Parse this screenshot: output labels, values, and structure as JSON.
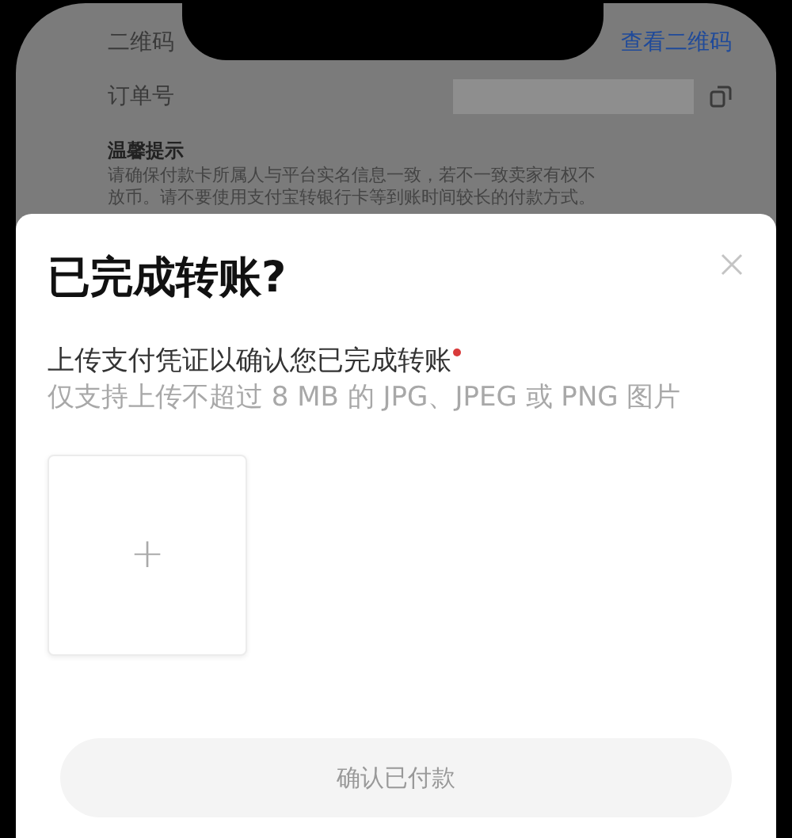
{
  "background_page": {
    "qr_label": "二维码",
    "qr_link": "查看二维码",
    "order_label": "订单号",
    "notice_title": "温馨提示",
    "notice_lines": [
      "请确保付款卡所属人与平台实名信息一致，若不一致卖家有权不",
      "放币。请不要使用支付宝转银行卡等到账时间较长的付款方式。"
    ]
  },
  "sheet": {
    "title": "已完成转账?",
    "label": "上传支付凭证以确认您已完成转账",
    "required": true,
    "hint": "仅支持上传不超过 8 MB 的 JPG、JPEG 或 PNG 图片",
    "upload_symbol": "+",
    "confirm_button": {
      "label": "确认已付款",
      "disabled": true
    }
  }
}
